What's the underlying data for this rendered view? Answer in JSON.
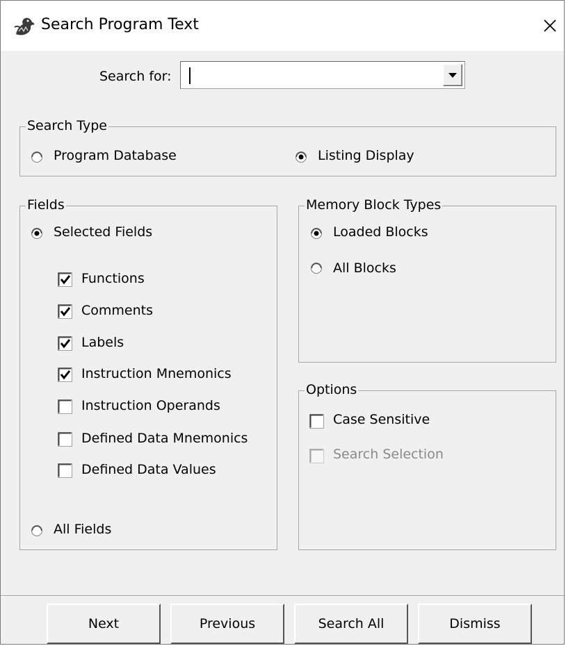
{
  "window": {
    "title": "Search Program Text",
    "icon": "dragon-icon",
    "close_icon": "close-icon"
  },
  "search": {
    "label": "Search for:",
    "value": "",
    "placeholder": ""
  },
  "search_type": {
    "legend": "Search Type",
    "options": [
      {
        "label": "Program Database",
        "selected": false
      },
      {
        "label": "Listing Display",
        "selected": true
      }
    ]
  },
  "fields": {
    "legend": "Fields",
    "selected_fields_label": "Selected Fields",
    "selected_fields_selected": true,
    "items": [
      {
        "label": "Functions",
        "checked": true
      },
      {
        "label": "Comments",
        "checked": true
      },
      {
        "label": "Labels",
        "checked": true
      },
      {
        "label": "Instruction Mnemonics",
        "checked": true
      },
      {
        "label": "Instruction Operands",
        "checked": false
      },
      {
        "label": "Defined Data Mnemonics",
        "checked": false
      },
      {
        "label": "Defined Data Values",
        "checked": false
      }
    ],
    "all_fields_label": "All Fields",
    "all_fields_selected": false
  },
  "memory_block_types": {
    "legend": "Memory Block Types",
    "options": [
      {
        "label": "Loaded Blocks",
        "selected": true
      },
      {
        "label": "All Blocks",
        "selected": false
      }
    ]
  },
  "options": {
    "legend": "Options",
    "items": [
      {
        "label": "Case Sensitive",
        "checked": false,
        "enabled": true
      },
      {
        "label": "Search Selection",
        "checked": false,
        "enabled": false
      }
    ]
  },
  "buttons": {
    "next": "Next",
    "previous": "Previous",
    "search_all": "Search All",
    "dismiss": "Dismiss"
  },
  "colors": {
    "window_bg": "#f0f0f0",
    "titlebar_bg": "#ffffff",
    "disabled_text": "#8a8a8a"
  }
}
